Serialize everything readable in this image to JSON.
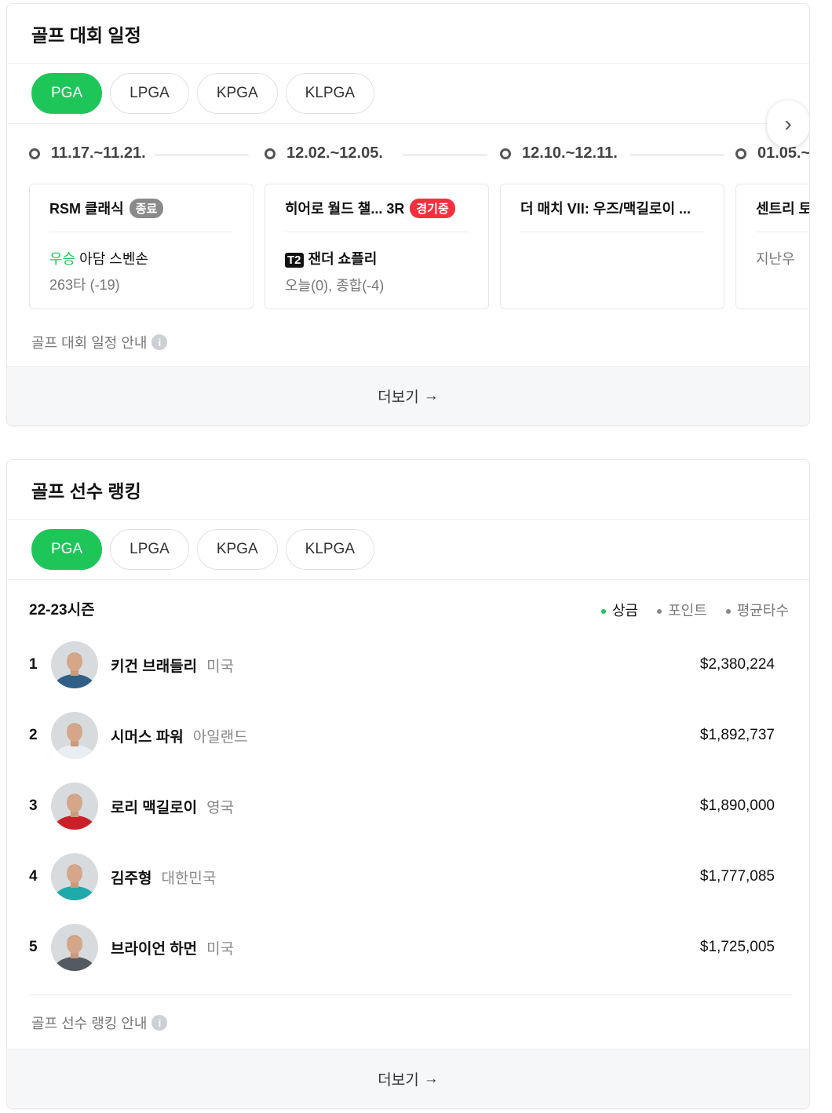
{
  "schedule": {
    "title": "골프 대회 일정",
    "tabs": [
      "PGA",
      "LPGA",
      "KPGA",
      "KLPGA"
    ],
    "active_tab": "PGA",
    "events": [
      {
        "date": "11.17.~11.21.",
        "title": "RSM 클래식",
        "badge": "종료",
        "badge_color": "#8a8a8a",
        "line1_prefix": "우승",
        "line1": "아담 스벤손",
        "line2": "263타 (-19)"
      },
      {
        "date": "12.02.~12.05.",
        "title": "히어로 월드 챌... 3R",
        "badge": "경기중",
        "badge_color": "#f5303e",
        "line1_prefix": "T2",
        "line1": "잰더 쇼플리",
        "line2": "오늘(0), 종합(-4)"
      },
      {
        "date": "12.10.~12.11.",
        "title": "더 매치 VII: 우즈/맥길로이 ...",
        "badge": "",
        "line1_prefix": "",
        "line1": "",
        "line2": ""
      },
      {
        "date": "01.05.~",
        "title": "센트리 토",
        "badge": "",
        "line1_prefix": "",
        "line1": "지난우",
        "line2": ""
      }
    ],
    "info": "골프 대회 일정 안내",
    "more": "더보기"
  },
  "ranking": {
    "title": "골프 선수 랭킹",
    "tabs": [
      "PGA",
      "LPGA",
      "KPGA",
      "KLPGA"
    ],
    "active_tab": "PGA",
    "season": "22-23시즌",
    "sort": [
      "상금",
      "포인트",
      "평균타수"
    ],
    "active_sort": "상금",
    "players": [
      {
        "rank": "1",
        "name": "키건 브래들리",
        "country": "미국",
        "prize": "$2,380,224",
        "shirt": "#2f5f86"
      },
      {
        "rank": "2",
        "name": "시머스 파워",
        "country": "아일랜드",
        "prize": "$1,892,737",
        "shirt": "#e9eef2"
      },
      {
        "rank": "3",
        "name": "로리 맥길로이",
        "country": "영국",
        "prize": "$1,890,000",
        "shirt": "#c9202a"
      },
      {
        "rank": "4",
        "name": "김주형",
        "country": "대한민국",
        "prize": "$1,777,085",
        "shirt": "#1fa9a8"
      },
      {
        "rank": "5",
        "name": "브라이언 하먼",
        "country": "미국",
        "prize": "$1,725,005",
        "shirt": "#555a60"
      }
    ],
    "info": "골프 선수 랭킹 안내",
    "more": "더보기"
  },
  "colors": {
    "accent": "#1ec65a",
    "live": "#f5303e"
  }
}
